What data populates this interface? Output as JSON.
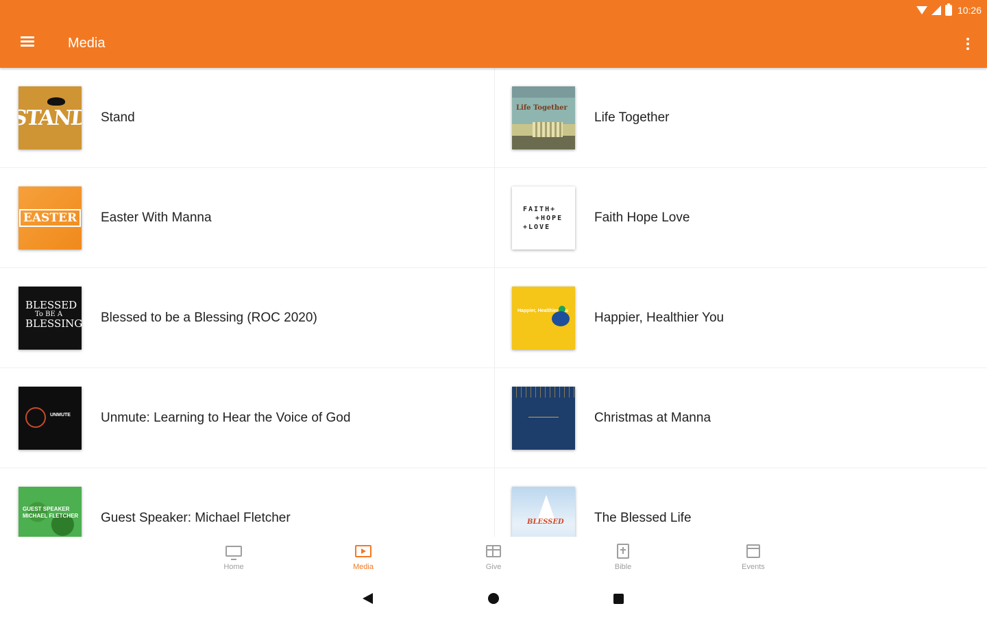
{
  "status_bar": {
    "time": "10:26"
  },
  "app_bar": {
    "title": "Media"
  },
  "media_items": [
    {
      "label": "Stand",
      "thumb_text": "STAND"
    },
    {
      "label": "Life Together",
      "thumb_text": "Life Together"
    },
    {
      "label": "Easter With Manna",
      "thumb_text": "EASTER"
    },
    {
      "label": "Faith Hope Love",
      "thumb_text": [
        "FAITH+",
        "+HOPE",
        "+LOVE"
      ]
    },
    {
      "label": "Blessed to be a Blessing (ROC 2020)",
      "thumb_text": [
        "BLESSED",
        "To BE A",
        "BLESSING"
      ]
    },
    {
      "label": "Happier, Healthier You",
      "thumb_text": "Happier, Healthier You"
    },
    {
      "label": "Unmute: Learning to Hear the Voice of God",
      "thumb_text": "UNMUTE"
    },
    {
      "label": "Christmas at Manna",
      "thumb_text": ""
    },
    {
      "label": "Guest Speaker:  Michael Fletcher",
      "thumb_text": [
        "GUEST SPEAKER",
        "MICHAEL FLETCHER"
      ]
    },
    {
      "label": "The Blessed Life",
      "thumb_text": "BLESSED"
    }
  ],
  "bottom_nav": [
    {
      "label": "Home",
      "icon": "tv-icon"
    },
    {
      "label": "Media",
      "icon": "media-play-icon",
      "active": true
    },
    {
      "label": "Give",
      "icon": "gift-icon"
    },
    {
      "label": "Bible",
      "icon": "bible-icon"
    },
    {
      "label": "Events",
      "icon": "calendar-icon"
    }
  ],
  "colors": {
    "primary": "#f27922",
    "inactive_nav": "#9e9e9e"
  }
}
